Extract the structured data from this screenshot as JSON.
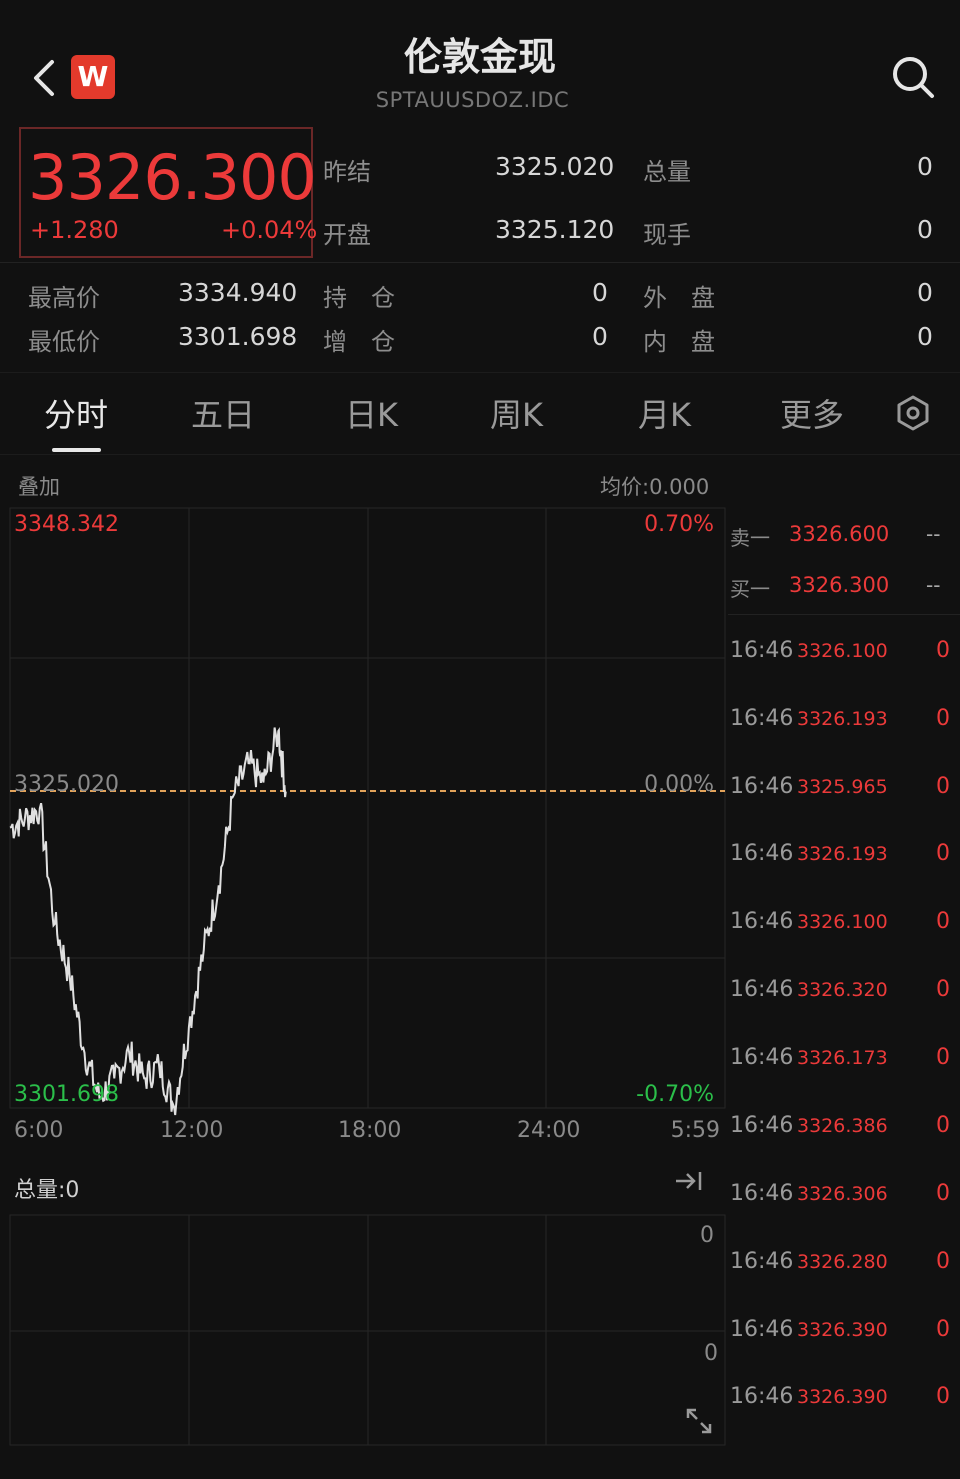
{
  "header": {
    "title": "伦敦金现",
    "subtitle": "SPTAUUSDOZ.IDC",
    "logo_letter": "W"
  },
  "quote": {
    "price": "3326.300",
    "change": "+1.280",
    "change_pct": "+0.04%",
    "prev_close_label": "昨结",
    "prev_close": "3325.020",
    "open_label": "开盘",
    "open": "3325.120",
    "total_vol_label": "总量",
    "total_vol": "0",
    "cur_hand_label": "现手",
    "cur_hand": "0",
    "high_label": "最高价",
    "high": "3334.940",
    "low_label": "最低价",
    "low": "3301.698",
    "oi_label": "持　仓",
    "oi": "0",
    "oi_inc_label": "增　仓",
    "oi_inc": "0",
    "outer_label": "外　盘",
    "outer": "0",
    "inner_label": "内　盘",
    "inner": "0"
  },
  "tabs": [
    {
      "label": "分时",
      "active": true
    },
    {
      "label": "五日"
    },
    {
      "label": "日K"
    },
    {
      "label": "周K"
    },
    {
      "label": "月K"
    },
    {
      "label": "更多"
    }
  ],
  "chart": {
    "overlay_label": "叠加",
    "avg_label": "均价:0.000",
    "max_price": "3348.342",
    "max_pct": "0.70%",
    "ref_price": "3325.020",
    "ref_pct": "0.00%",
    "min_price": "3301.698",
    "min_pct": "-0.70%",
    "x_ticks": [
      "6:00",
      "12:00",
      "18:00",
      "24:00",
      "5:59"
    ],
    "volume_label": "总量:0",
    "vol_top": "0",
    "vol_mid": "0",
    "colors": {
      "up": "#ec3a3a",
      "down": "#2bbf4a",
      "line": "#e0e0e0",
      "ref": "#e3a35a"
    }
  },
  "chart_data": {
    "type": "line",
    "ylim": [
      3301.698,
      3348.342
    ],
    "x_range": [
      "6:00",
      "5:59"
    ],
    "reference": 3325.02,
    "series": [
      {
        "x": [
          "6:00",
          "6:30",
          "7:00",
          "7:30",
          "8:00",
          "8:30",
          "9:00",
          "9:30",
          "10:00",
          "10:30",
          "11:00",
          "11:30",
          "12:00",
          "12:30",
          "13:00",
          "13:30",
          "14:00",
          "14:30",
          "15:00",
          "15:15"
        ],
        "values": [
          3323.5,
          3324.2,
          3325.0,
          3316.0,
          3312.0,
          3306.0,
          3302.5,
          3304.0,
          3306.0,
          3304.0,
          3305.0,
          3301.8,
          3308.0,
          3314.0,
          3319.0,
          3326.0,
          3328.5,
          3327.0,
          3331.0,
          3326.3
        ]
      }
    ]
  },
  "orderbook": {
    "sell1_label": "卖一",
    "sell1_price": "3326.600",
    "sell1_vol": "--",
    "buy1_label": "买一",
    "buy1_price": "3326.300",
    "buy1_vol": "--"
  },
  "ticks": [
    {
      "time": "16:46",
      "price": "3326.100",
      "vol": "0"
    },
    {
      "time": "16:46",
      "price": "3326.193",
      "vol": "0"
    },
    {
      "time": "16:46",
      "price": "3325.965",
      "vol": "0"
    },
    {
      "time": "16:46",
      "price": "3326.193",
      "vol": "0"
    },
    {
      "time": "16:46",
      "price": "3326.100",
      "vol": "0"
    },
    {
      "time": "16:46",
      "price": "3326.320",
      "vol": "0"
    },
    {
      "time": "16:46",
      "price": "3326.173",
      "vol": "0"
    },
    {
      "time": "16:46",
      "price": "3326.386",
      "vol": "0"
    },
    {
      "time": "16:46",
      "price": "3326.306",
      "vol": "0"
    },
    {
      "time": "16:46",
      "price": "3326.280",
      "vol": "0"
    },
    {
      "time": "16:46",
      "price": "3326.390",
      "vol": "0"
    },
    {
      "time": "16:46",
      "price": "3326.390",
      "vol": "0"
    }
  ]
}
